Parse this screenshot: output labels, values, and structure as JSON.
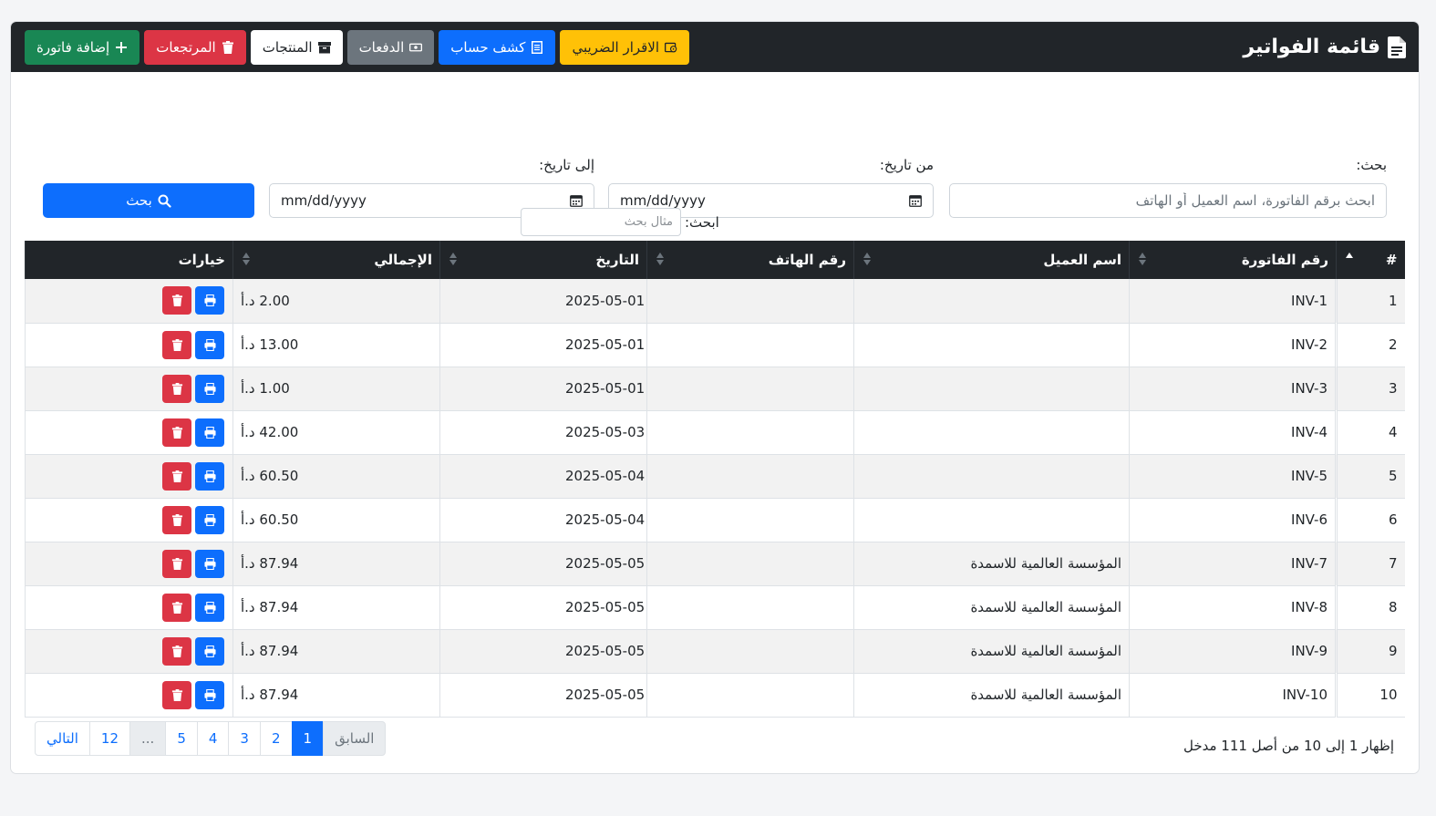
{
  "header": {
    "title": "قائمة الفواتير",
    "actions": {
      "add_invoice": "إضافة فاتورة",
      "returns": "المرتجعات",
      "products": "المنتجات",
      "payments": "الدفعات",
      "statement": "كشف حساب",
      "tax_return": "الاقرار الضريبي"
    }
  },
  "filters": {
    "search_label": "بحث:",
    "search_placeholder": "ابحث برقم الفاتورة، اسم العميل أو الهاتف",
    "from_label": "من تاريخ:",
    "from_value": "mm/dd/yyyy",
    "to_label": "إلى تاريخ:",
    "to_value": "mm/dd/yyyy",
    "submit_label": "بحث"
  },
  "table_search": {
    "label": "ابحث:",
    "placeholder": "مثال بحث"
  },
  "table": {
    "columns": [
      "#",
      "رقم الفاتورة",
      "اسم العميل",
      "رقم الهاتف",
      "التاريخ",
      "الإجمالي",
      "خيارات"
    ],
    "rows": [
      {
        "num": "1",
        "invoice": "INV-1",
        "customer": "",
        "phone": "",
        "date": "2025-05-01",
        "total": "2.00 د.أ"
      },
      {
        "num": "2",
        "invoice": "INV-2",
        "customer": "",
        "phone": "",
        "date": "2025-05-01",
        "total": "13.00 د.أ"
      },
      {
        "num": "3",
        "invoice": "INV-3",
        "customer": "",
        "phone": "",
        "date": "2025-05-01",
        "total": "1.00 د.أ"
      },
      {
        "num": "4",
        "invoice": "INV-4",
        "customer": "",
        "phone": "",
        "date": "2025-05-03",
        "total": "42.00 د.أ"
      },
      {
        "num": "5",
        "invoice": "INV-5",
        "customer": "",
        "phone": "",
        "date": "2025-05-04",
        "total": "60.50 د.أ"
      },
      {
        "num": "6",
        "invoice": "INV-6",
        "customer": "",
        "phone": "",
        "date": "2025-05-04",
        "total": "60.50 د.أ"
      },
      {
        "num": "7",
        "invoice": "INV-7",
        "customer": "المؤسسة العالمية للاسمدة",
        "phone": "",
        "date": "2025-05-05",
        "total": "87.94 د.أ"
      },
      {
        "num": "8",
        "invoice": "INV-8",
        "customer": "المؤسسة العالمية للاسمدة",
        "phone": "",
        "date": "2025-05-05",
        "total": "87.94 د.أ"
      },
      {
        "num": "9",
        "invoice": "INV-9",
        "customer": "المؤسسة العالمية للاسمدة",
        "phone": "",
        "date": "2025-05-05",
        "total": "87.94 د.أ"
      },
      {
        "num": "10",
        "invoice": "INV-10",
        "customer": "المؤسسة العالمية للاسمدة",
        "phone": "",
        "date": "2025-05-05",
        "total": "87.94 د.أ"
      }
    ]
  },
  "footer": {
    "info": "إظهار 1 إلى 10 من أصل 111 مدخل",
    "pagination": [
      "التالي",
      "12",
      "...",
      "5",
      "4",
      "3",
      "2",
      "1",
      "السابق"
    ],
    "active_page": "1"
  },
  "colors": {
    "header_bg": "#212529",
    "primary": "#0d6efd",
    "success": "#198754",
    "danger": "#dc3545",
    "warning": "#ffc107",
    "secondary": "#6c757d"
  }
}
